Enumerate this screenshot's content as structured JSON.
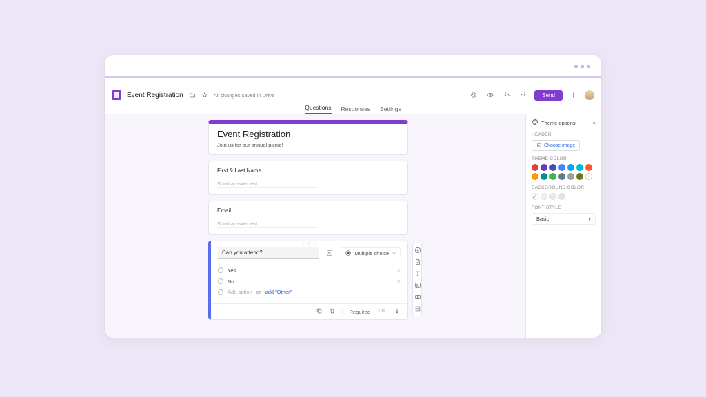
{
  "doc": {
    "title": "Event Registration",
    "save_status": "All changes saved in Drive"
  },
  "topbar": {
    "send_label": "Send"
  },
  "tabs": {
    "questions": "Questions",
    "responses": "Responses",
    "settings": "Settings"
  },
  "form": {
    "title": "Event Registration",
    "description": "Join us for our annual picnic!"
  },
  "q1": {
    "title": "First & Last Name",
    "placeholder": "Short answer text"
  },
  "q2": {
    "title": "Email",
    "placeholder": "Short answer text"
  },
  "q3": {
    "title": "Can you attend?",
    "type_label": "Multiple choice",
    "option1": "Yes",
    "option2": "No",
    "add_option": "Add option",
    "or": "or",
    "add_other": "add \"Other\"",
    "required_label": "Required"
  },
  "theme": {
    "panel_title": "Theme options",
    "header_label": "HEADER",
    "choose_image": "Choose image",
    "theme_color_label": "THEME COLOR",
    "colors": {
      "c0": "#db4437",
      "c1": "#673ab7",
      "c2": "#3f51b5",
      "c3": "#4285f4",
      "c4": "#03a9f4",
      "c5": "#00bcd4",
      "c6": "#ff5722",
      "c7": "#ff9800",
      "c8": "#009688",
      "c9": "#4caf50",
      "c10": "#607d8b",
      "c11": "#9e9e9e",
      "c12": "#6b7d1a"
    },
    "bg_label": "BACKGROUND COLOR",
    "bg": {
      "b0": "#ffffff",
      "b1": "#f6edf6",
      "b2": "#efe6f3",
      "b3": "#e9def0"
    },
    "font_label": "FONT STYLE",
    "font_value": "Basic"
  }
}
